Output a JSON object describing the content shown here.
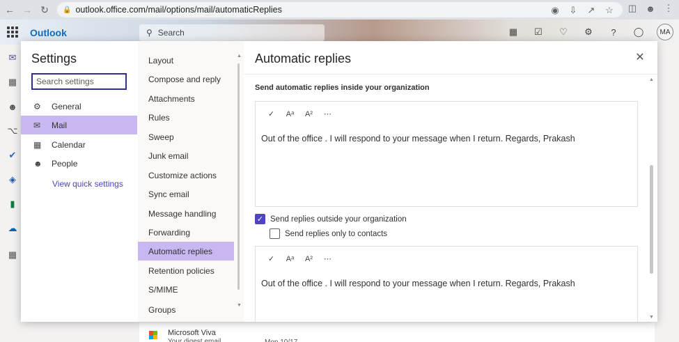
{
  "browser": {
    "url": "outlook.office.com/mail/options/mail/automaticReplies"
  },
  "outlook": {
    "brand": "Outlook",
    "search_placeholder": "Search",
    "avatar_initials": "MA"
  },
  "settings": {
    "title": "Settings",
    "search_placeholder": "Search settings",
    "categories": [
      {
        "label": "General",
        "icon": "gear-icon"
      },
      {
        "label": "Mail",
        "icon": "mail-icon"
      },
      {
        "label": "Calendar",
        "icon": "calendar-icon"
      },
      {
        "label": "People",
        "icon": "people-icon"
      }
    ],
    "active_category": "Mail",
    "quick_settings_link": "View quick settings",
    "mail_subitems": [
      "Layout",
      "Compose and reply",
      "Attachments",
      "Rules",
      "Sweep",
      "Junk email",
      "Customize actions",
      "Sync email",
      "Message handling",
      "Forwarding",
      "Automatic replies",
      "Retention policies",
      "S/MIME",
      "Groups"
    ],
    "active_subitem": "Automatic replies"
  },
  "automatic_replies": {
    "title": "Automatic replies",
    "inside_label": "Send automatic replies inside your organization",
    "inside_message": "Out of the office . I will respond to your message when I return. Regards, Prakash",
    "outside_checkbox_label": "Send replies outside your organization",
    "outside_checked": true,
    "contacts_only_label": "Send replies only to contacts",
    "contacts_only_checked": false,
    "outside_message": "Out of the office . I will respond to your message when I return. Regards, Prakash"
  },
  "background_mail": {
    "sender": "Microsoft Viva",
    "subject": "Your digest email",
    "date": "Mon 10/17"
  },
  "colors": {
    "accent": "#4f44c4",
    "selection": "#c8b7f0",
    "brand": "#0f6cbd"
  }
}
